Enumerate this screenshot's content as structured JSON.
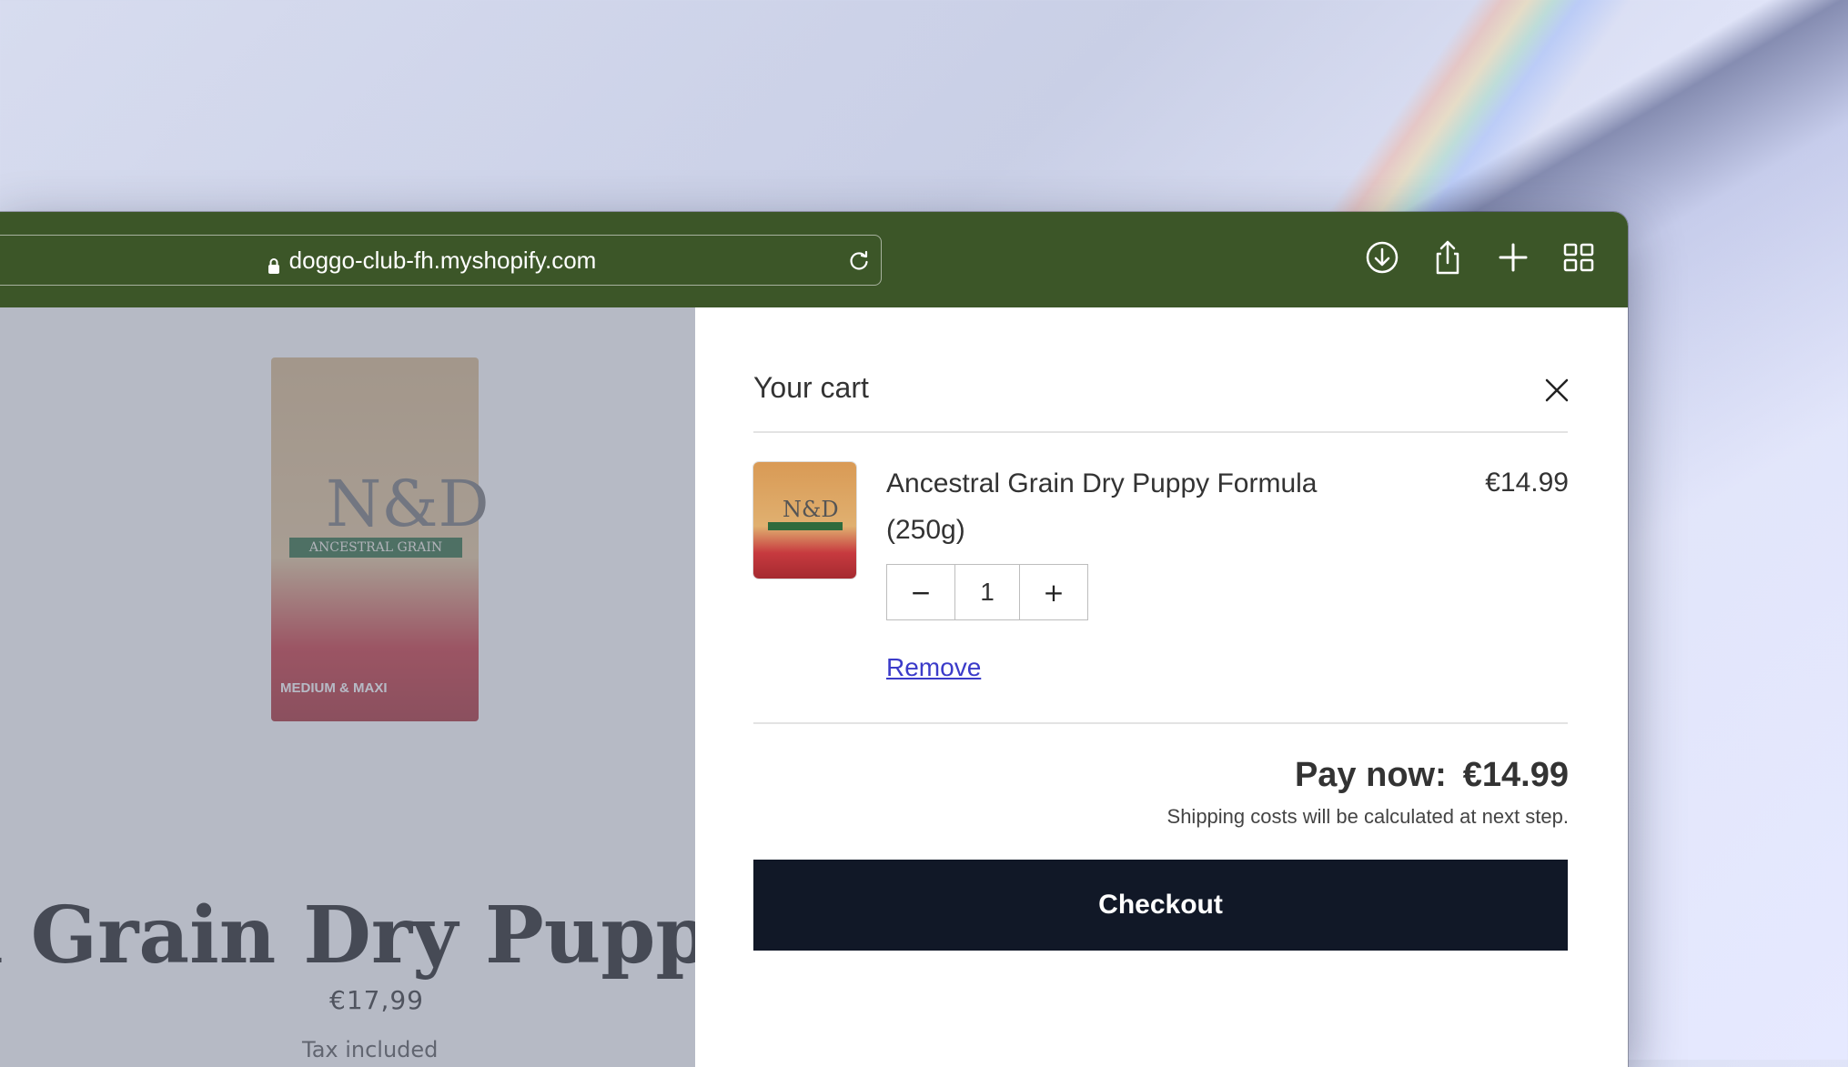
{
  "browser": {
    "url": "doggo-club-fh.myshopify.com",
    "icons": [
      "download-icon",
      "share-icon",
      "new-tab-icon",
      "tab-overview-icon"
    ]
  },
  "product": {
    "title": "ral Grain Dry Puppy F",
    "price": "€17,99",
    "tax_note": "Tax included"
  },
  "package": {
    "logo": "N&D",
    "band": "ANCESTRAL GRAIN",
    "bottom": "MEDIUM & MAXI"
  },
  "cart": {
    "title": "Your cart",
    "item": {
      "name": "Ancestral Grain Dry Puppy Formula (250g)",
      "price": "€14.99",
      "quantity": "1",
      "decrement": "−",
      "increment": "+",
      "remove_label": "Remove"
    },
    "pay_now_label": "Pay now:",
    "pay_now_amount": "€14.99",
    "shipping_note": "Shipping costs will be calculated at next step.",
    "checkout_label": "Checkout"
  },
  "colors": {
    "toolbar": "#3c5628",
    "checkout_button": "#111827",
    "link": "#3b3bc9"
  }
}
